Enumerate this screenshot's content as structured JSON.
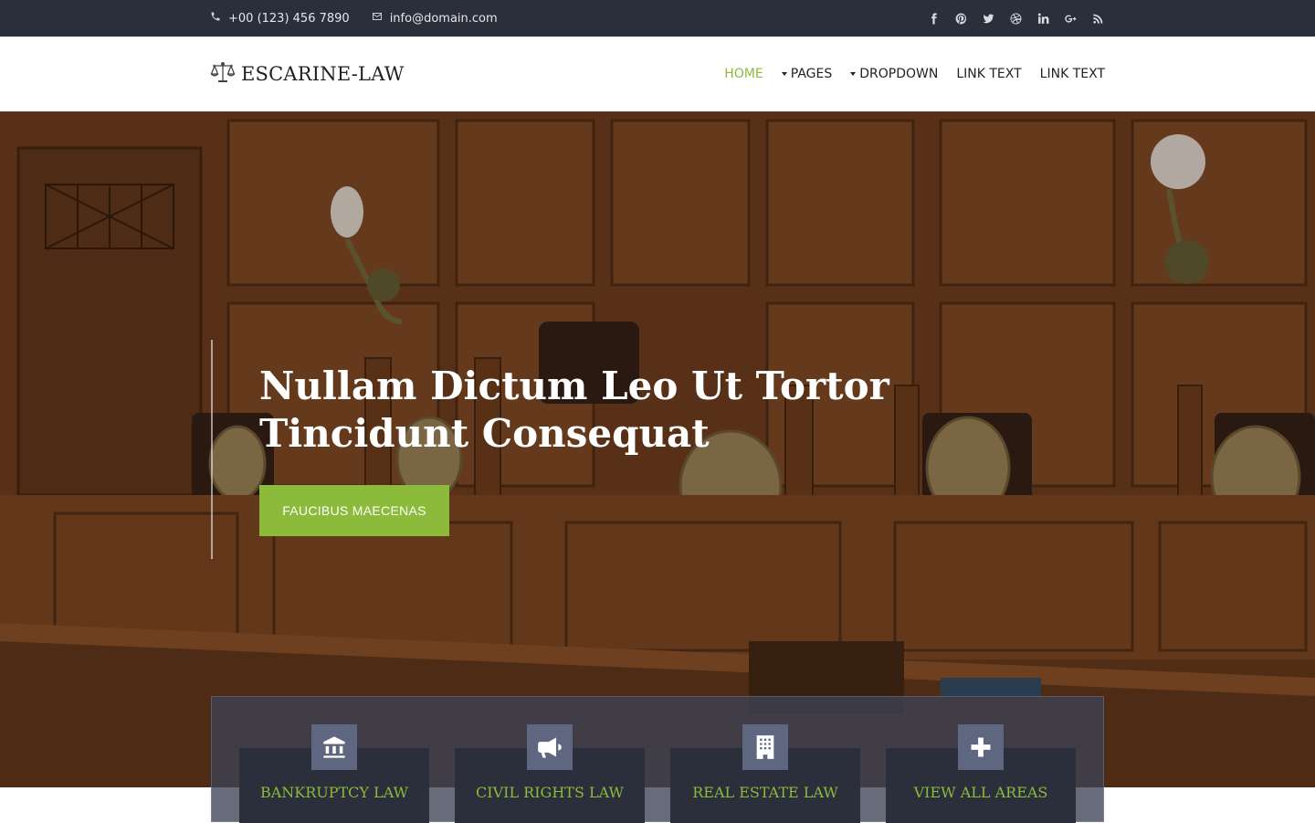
{
  "topbar": {
    "phone": "+00 (123) 456 7890",
    "email": "info@domain.com",
    "social_icons": [
      "facebook-icon",
      "pinterest-icon",
      "twitter-icon",
      "dribbble-icon",
      "linkedin-icon",
      "google-plus-icon",
      "rss-icon"
    ]
  },
  "header": {
    "logo_text": "ESCARINE-LAW",
    "nav": [
      {
        "label": "HOME",
        "active": true,
        "dropdown": false
      },
      {
        "label": "PAGES",
        "active": false,
        "dropdown": true
      },
      {
        "label": "DROPDOWN",
        "active": false,
        "dropdown": true
      },
      {
        "label": "LINK TEXT",
        "active": false,
        "dropdown": false
      },
      {
        "label": "LINK TEXT",
        "active": false,
        "dropdown": false
      }
    ]
  },
  "hero": {
    "title_line1": "Nullam Dictum Leo Ut Tortor",
    "title_line2": "Tincidunt Consequat",
    "button_label": "FAUCIBUS MAECENAS"
  },
  "areas": [
    {
      "label": "BANKRUPTCY LAW",
      "icon": "bank-icon"
    },
    {
      "label": "CIVIL RIGHTS LAW",
      "icon": "megaphone-icon"
    },
    {
      "label": "REAL ESTATE LAW",
      "icon": "building-icon"
    },
    {
      "label": "VIEW ALL AREAS",
      "icon": "plus-icon"
    }
  ],
  "colors": {
    "accent": "#8cba3a",
    "topbar_bg": "#2a2f3b",
    "card_bg": "#2a2f3b",
    "icon_box": "#5f6680"
  }
}
